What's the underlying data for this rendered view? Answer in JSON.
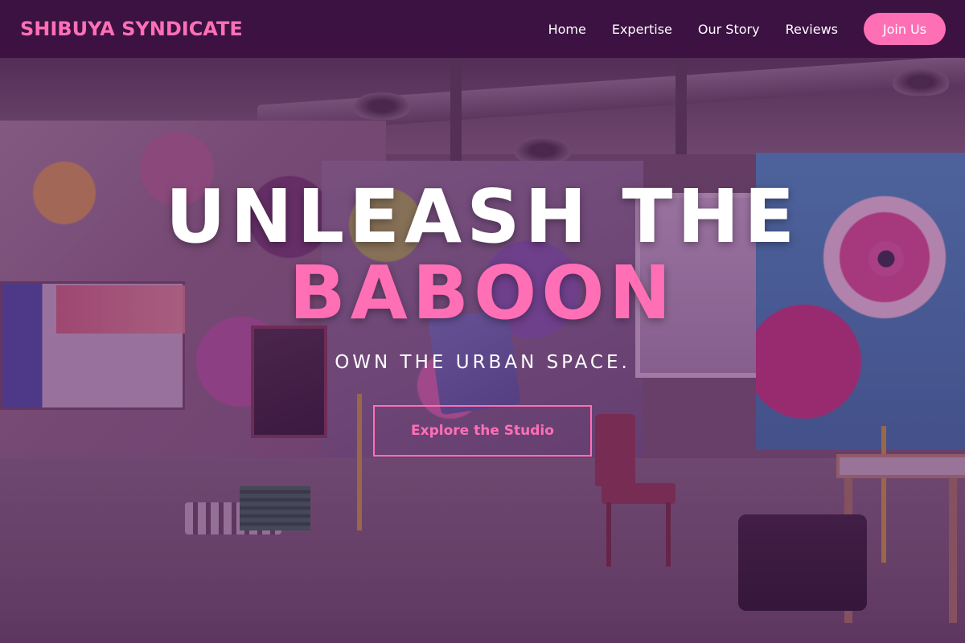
{
  "nav": {
    "brand": "SHIBUYA SYNDICATE",
    "links": [
      {
        "label": "Home"
      },
      {
        "label": "Expertise"
      },
      {
        "label": "Our Story"
      },
      {
        "label": "Reviews"
      }
    ],
    "join_label": "Join Us"
  },
  "hero": {
    "headline_line1": "UNLEASH THE",
    "headline_accent": "BABOON",
    "tagline": "OWN THE URBAN SPACE.",
    "cta_label": "Explore the Studio",
    "background_icon": "graffiti-studio-photo"
  },
  "colors": {
    "accent": "#ff6fb5",
    "nav_bg": "#380c3e",
    "overlay": "#602068"
  }
}
